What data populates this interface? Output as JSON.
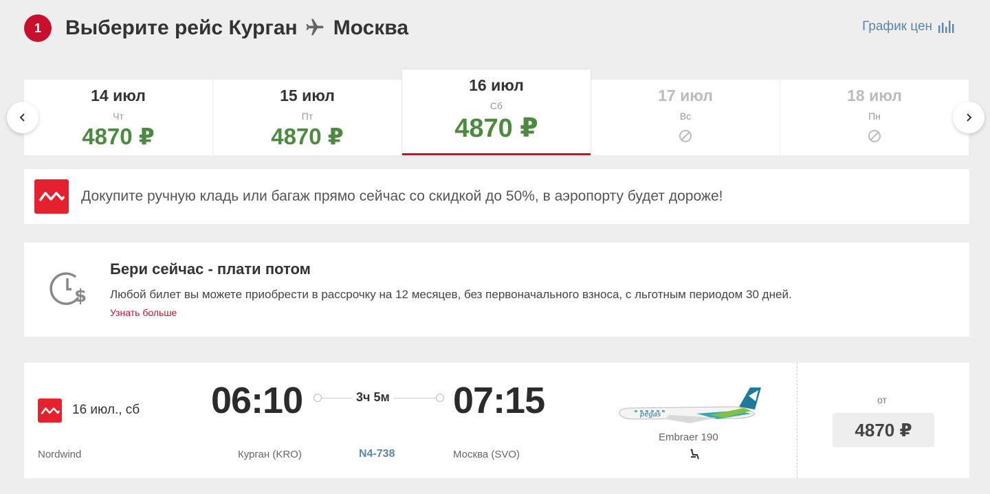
{
  "header": {
    "step": "1",
    "title_prefix": "Выберите рейс Курган",
    "title_destination": "Москва",
    "price_chart_label": "График цен"
  },
  "dates": [
    {
      "date": "14 июл",
      "weekday": "Чт",
      "price": "4870 ₽",
      "available": true
    },
    {
      "date": "15 июл",
      "weekday": "Пт",
      "price": "4870 ₽",
      "available": true
    },
    {
      "date": "16 июл",
      "weekday": "Сб",
      "price": "4870 ₽",
      "available": true,
      "selected": true
    },
    {
      "date": "17 июл",
      "weekday": "Вс",
      "price": "",
      "available": false
    },
    {
      "date": "18 июл",
      "weekday": "Пн",
      "price": "",
      "available": false
    }
  ],
  "banner": {
    "text": "Докупите ручную кладь или багаж прямо сейчас со скидкой до 50%, в аэропорту будет дороже!"
  },
  "promo": {
    "title": "Бери сейчас - плати потом",
    "text": "Любой билет вы можете приобрести в рассрочку на 12 месяцев, без первоначального взноса, с льготным периодом 30 дней.",
    "link": "Узнать больше"
  },
  "flight": {
    "date": "16 июл., сб",
    "airline": "Nordwind",
    "departure_time": "06:10",
    "arrival_time": "07:15",
    "duration": "3ч 5м",
    "departure_city": "Курган (KRO)",
    "arrival_city": "Москва (SVO)",
    "flight_number": "N4-738",
    "aircraft": "Embraer 190",
    "aircraft_livery_text": "pegas",
    "price_prefix": "от",
    "price": "4870 ₽"
  },
  "colors": {
    "accent_red": "#c8102e",
    "price_green": "#4b8a3f",
    "link_blue": "#5a87a8",
    "nordwind_red": "#e5212d"
  }
}
